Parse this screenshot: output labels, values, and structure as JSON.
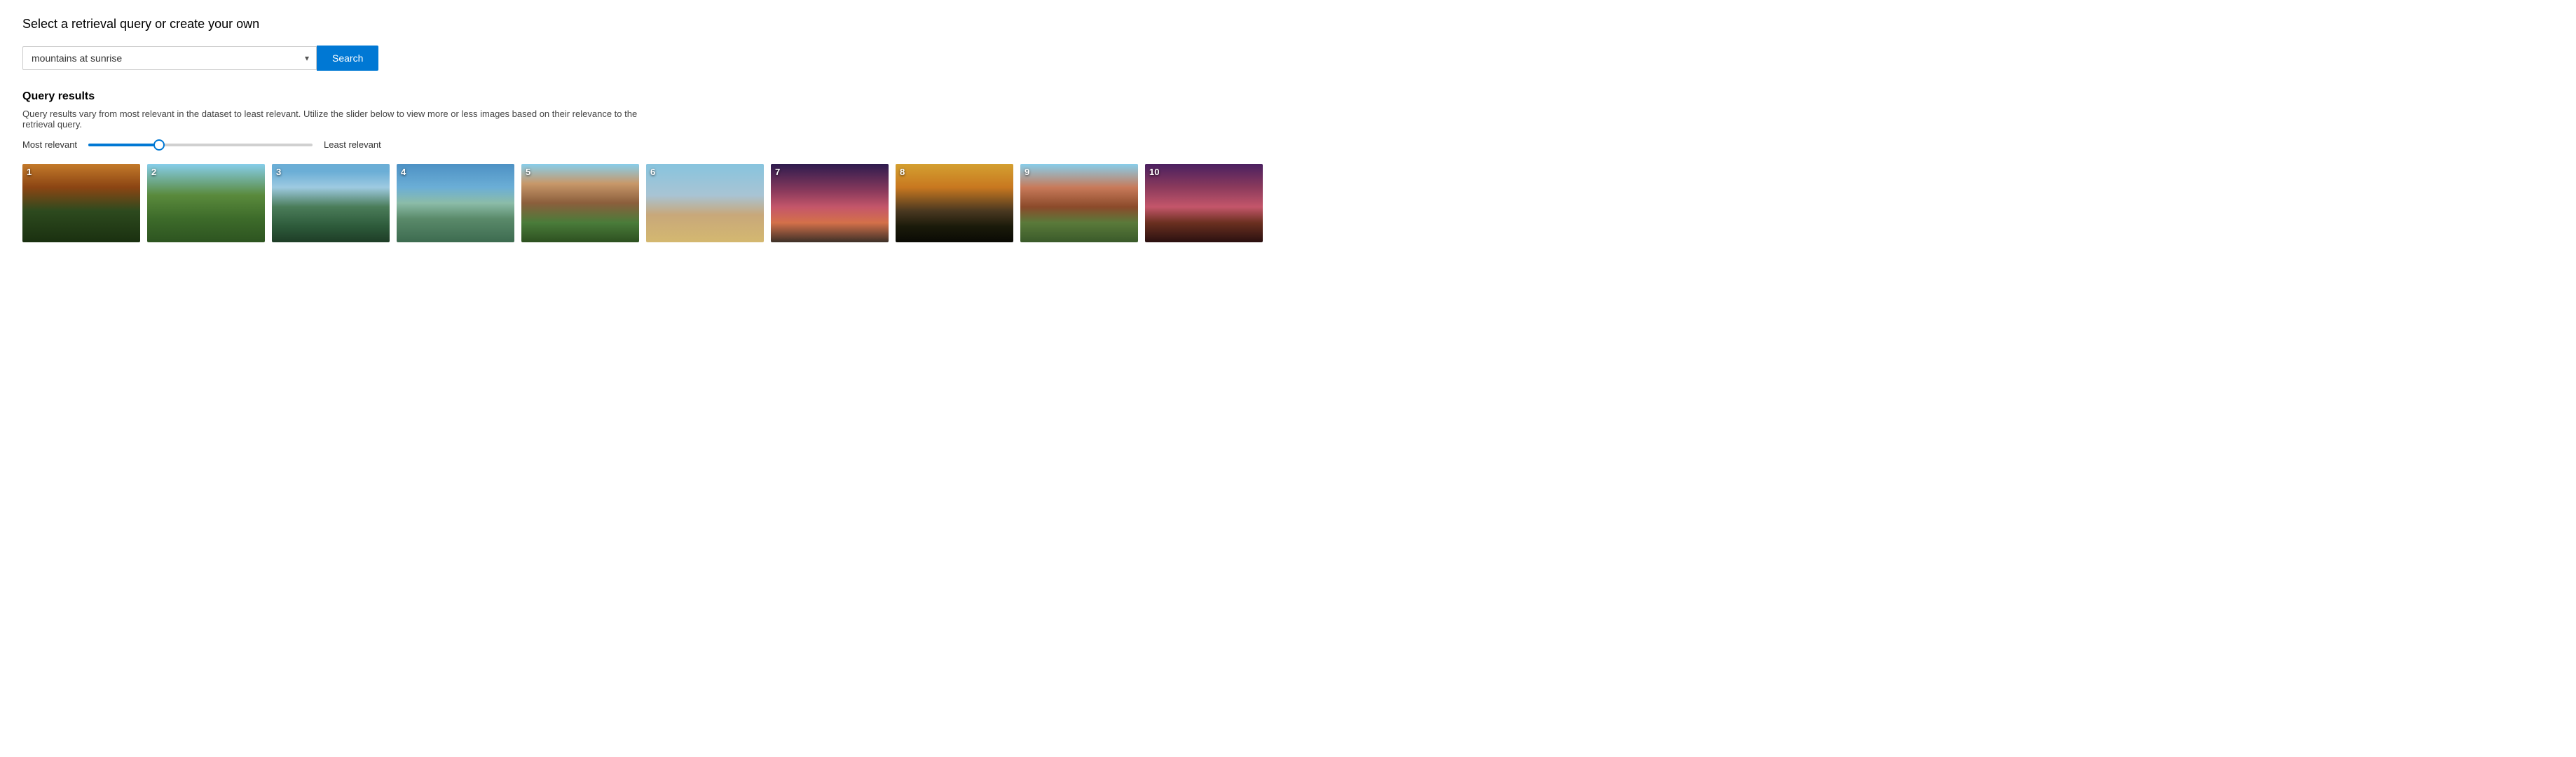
{
  "header": {
    "title": "Select a retrieval query or create your own"
  },
  "search": {
    "input_value": "mountains at sunrise",
    "placeholder": "mountains at sunrise",
    "button_label": "Search",
    "dropdown_arrow": "▾"
  },
  "results": {
    "section_title": "Query results",
    "description": "Query results vary from most relevant in the dataset to least relevant. Utilize the slider below to view more or less images based on their relevance to the retrieval query.",
    "most_relevant_label": "Most relevant",
    "least_relevant_label": "Least relevant",
    "images": [
      {
        "number": "1"
      },
      {
        "number": "2"
      },
      {
        "number": "3"
      },
      {
        "number": "4"
      },
      {
        "number": "5"
      },
      {
        "number": "6"
      },
      {
        "number": "7"
      },
      {
        "number": "8"
      },
      {
        "number": "9"
      },
      {
        "number": "10"
      }
    ]
  }
}
